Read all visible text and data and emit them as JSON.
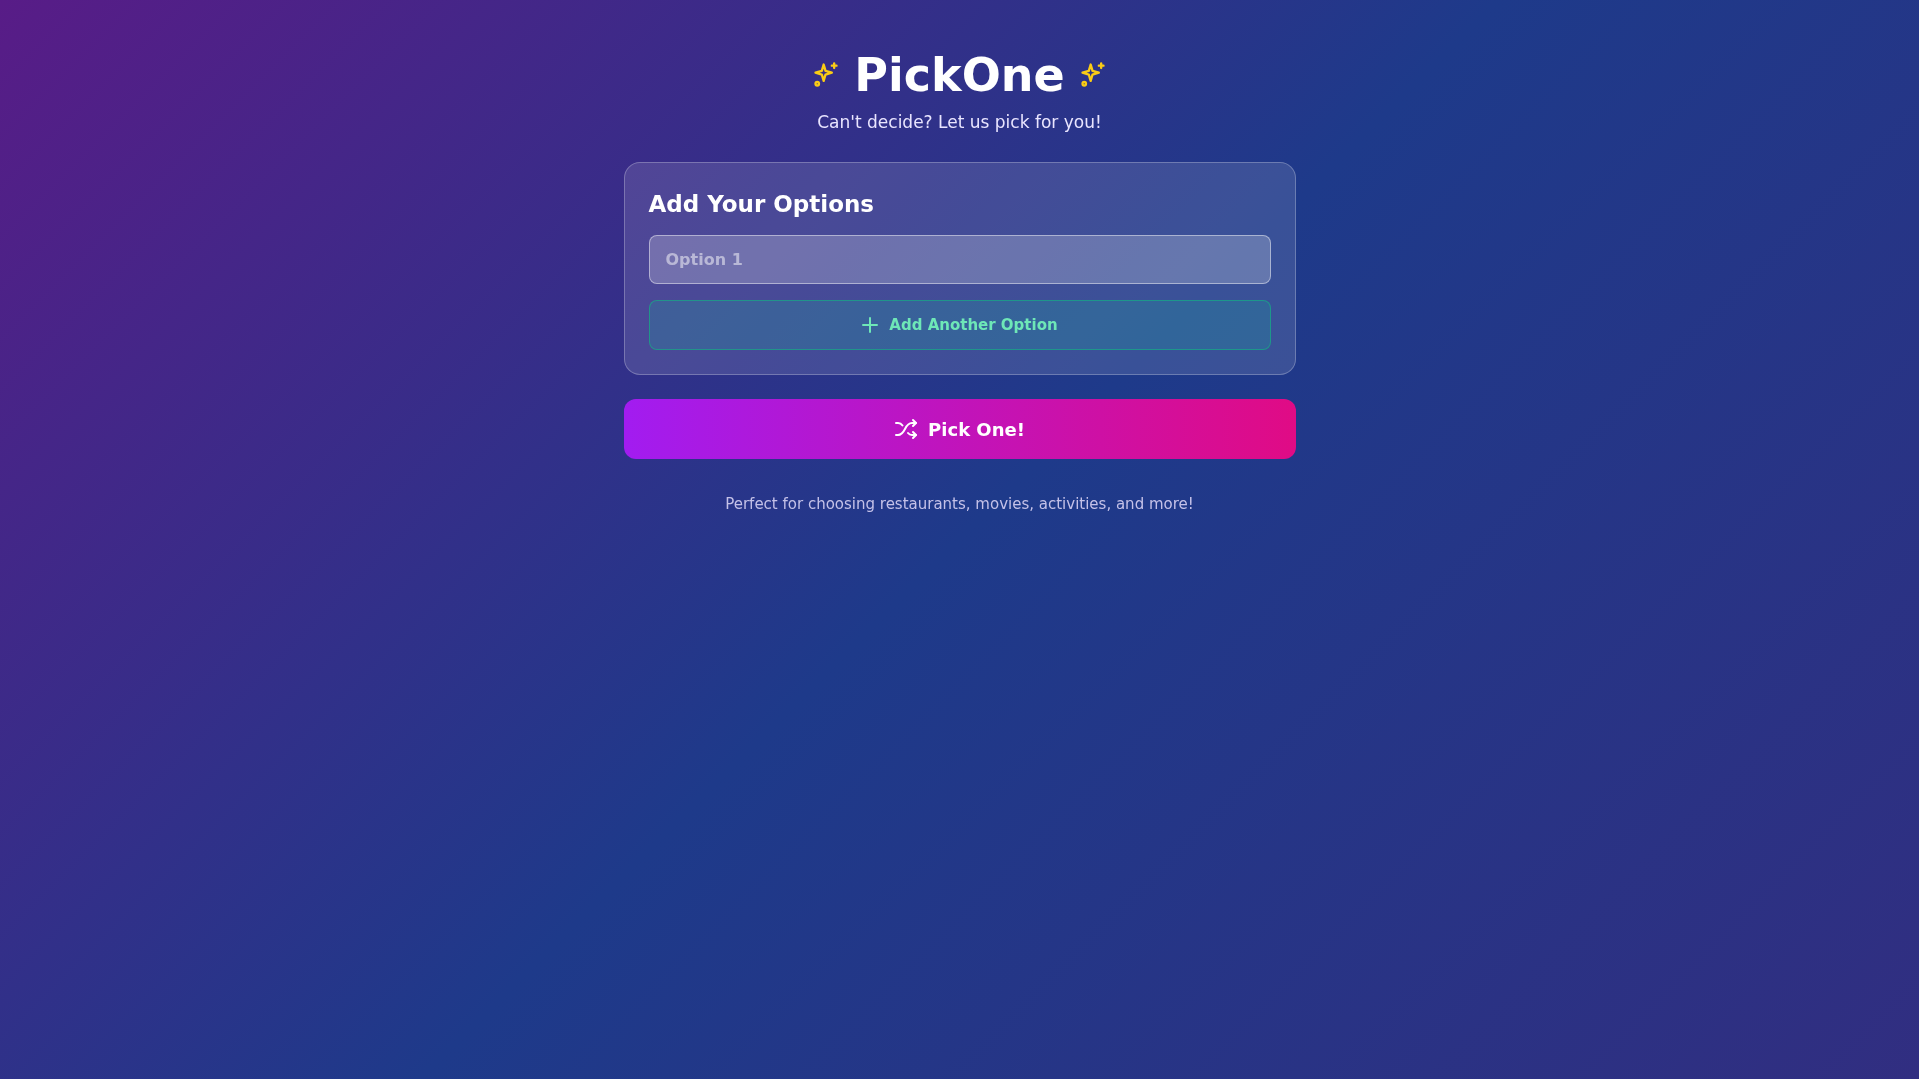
{
  "header": {
    "title": "PickOne",
    "subtitle": "Can't decide? Let us pick for you!"
  },
  "options_card": {
    "heading": "Add Your Options",
    "options": [
      {
        "placeholder": "Option 1"
      }
    ],
    "add_button": "Add Another Option"
  },
  "pick_button": "Pick One!",
  "footer": "Perfect for choosing restaurants, movies, activities, and more!"
}
